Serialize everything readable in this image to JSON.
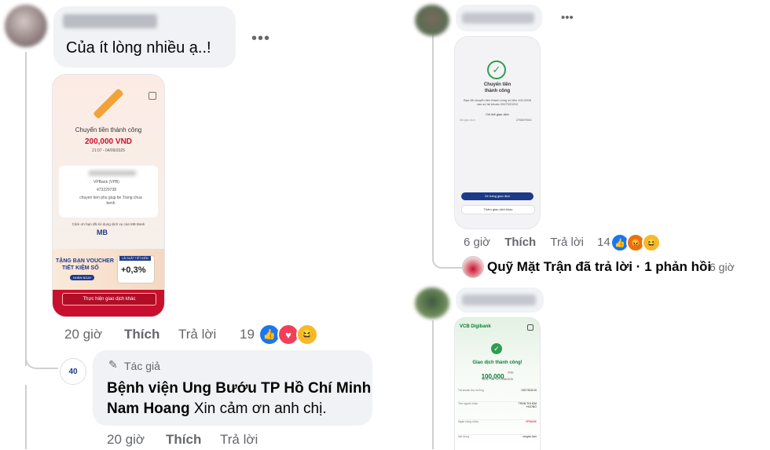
{
  "left_comment": {
    "text": "Của ít lòng nhiều ạ..!",
    "time": "20 giờ",
    "like": "Thích",
    "reply": "Trả lời",
    "reaction_count": "19",
    "receipt": {
      "title": "Chuyển tiền thành công",
      "amount": "200,000 VND",
      "datetime": "21:07 - 04/09/2025",
      "bank": "VPBank (VPB)",
      "account": "473229738",
      "message": "chuyen tien phu giup be Trang chua benh",
      "thanks": "Cảm ơn bạn đã sử dụng dịch vụ của MB Bank",
      "mb_logo": "MB",
      "banner_line1": "TẶNG BẠN VOUCHER",
      "banner_line2": "TIẾT KIỆM SỐ",
      "banner_button": "NHẬN NGAY",
      "banner_tag": "LÃI SUẤT TIẾT KIỆM",
      "banner_rate": "+0,3%",
      "action_button": "Thực hiện giao dịch khác"
    }
  },
  "author_reply": {
    "badge": "Tác giả",
    "name_line1": "Bệnh viện Ung Bướu TP Hồ Chí Minh",
    "name_tag": "Nam Hoang",
    "text": "Xin cảm ơn anh chị.",
    "time": "20 giờ",
    "like": "Thích",
    "reply": "Trả lời",
    "avatar_text": "40"
  },
  "right_comment_1": {
    "time": "6 giờ",
    "like": "Thích",
    "reply": "Trả lời",
    "reaction_count": "14",
    "receipt": {
      "title_line1": "Chuyển tiền",
      "title_line2": "thành công",
      "desc": "Bạn đã chuyển tiền thành công số tiền 100,000đ vào số tài khoản 0927323210",
      "detail_link": "Chi tiết giao dịch",
      "ref_label": "Mã giao dịch",
      "ref_value": "2750079013",
      "btn_primary": "Về trang giao dịch",
      "btn_secondary": "Thêm giao dịch khác"
    },
    "replies_summary": "Quỹ Mặt Trận đã trả lời · 1 phản hồi",
    "replies_time": "6 giờ"
  },
  "right_comment_2": {
    "receipt": {
      "brand": "VCB Digibank",
      "title": "Giao dịch thành công!",
      "amount": "100,000",
      "currency": "VND",
      "datetime": "16:32 Thứ Tư 27/08/2025",
      "rows": [
        {
          "label": "Tài khoản thụ hưởng",
          "value": "0927323210"
        },
        {
          "label": "Tên người nhận",
          "value": "TRAN THI KIM HUONG"
        },
        {
          "label": "Ngân hàng nhận",
          "value": "VPBANK"
        },
        {
          "label": "Nội dung",
          "value": "chuyen tien"
        }
      ]
    }
  },
  "icons": [
    "more-icon",
    "like-icon",
    "heart-icon",
    "haha-icon",
    "angry-icon",
    "pen-icon",
    "check-icon",
    "home-icon"
  ],
  "colors": {
    "like_blue": "#1877f2",
    "heart_red": "#f33e58",
    "mb_red": "#c8102e",
    "vcb_green": "#0a7d3a"
  }
}
